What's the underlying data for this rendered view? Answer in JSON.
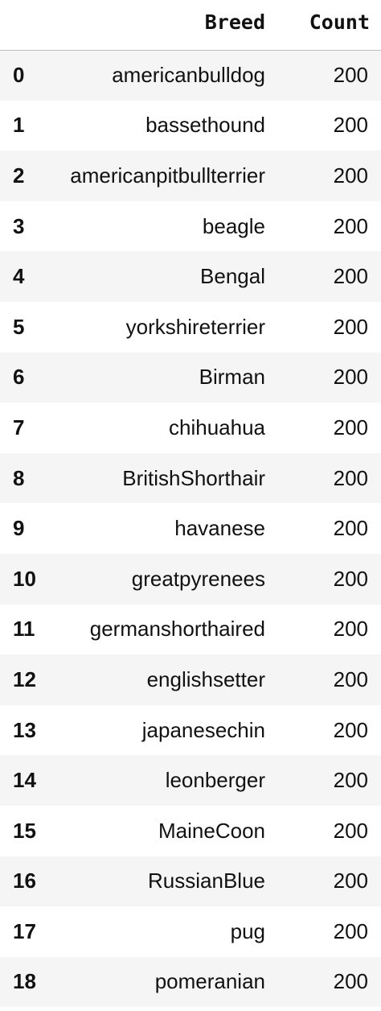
{
  "table": {
    "columns": {
      "index": "",
      "breed": "Breed",
      "count": "Count"
    },
    "rows": [
      {
        "index": "0",
        "breed": "americanbulldog",
        "count": "200"
      },
      {
        "index": "1",
        "breed": "bassethound",
        "count": "200"
      },
      {
        "index": "2",
        "breed": "americanpitbullterrier",
        "count": "200"
      },
      {
        "index": "3",
        "breed": "beagle",
        "count": "200"
      },
      {
        "index": "4",
        "breed": "Bengal",
        "count": "200"
      },
      {
        "index": "5",
        "breed": "yorkshireterrier",
        "count": "200"
      },
      {
        "index": "6",
        "breed": "Birman",
        "count": "200"
      },
      {
        "index": "7",
        "breed": "chihuahua",
        "count": "200"
      },
      {
        "index": "8",
        "breed": "BritishShorthair",
        "count": "200"
      },
      {
        "index": "9",
        "breed": "havanese",
        "count": "200"
      },
      {
        "index": "10",
        "breed": "greatpyrenees",
        "count": "200"
      },
      {
        "index": "11",
        "breed": "germanshorthaired",
        "count": "200"
      },
      {
        "index": "12",
        "breed": "englishsetter",
        "count": "200"
      },
      {
        "index": "13",
        "breed": "japanesechin",
        "count": "200"
      },
      {
        "index": "14",
        "breed": "leonberger",
        "count": "200"
      },
      {
        "index": "15",
        "breed": "MaineCoon",
        "count": "200"
      },
      {
        "index": "16",
        "breed": "RussianBlue",
        "count": "200"
      },
      {
        "index": "17",
        "breed": "pug",
        "count": "200"
      },
      {
        "index": "18",
        "breed": "pomeranian",
        "count": "200"
      }
    ]
  },
  "colors": {
    "stripe": "#f5f5f5",
    "background": "#ffffff",
    "text": "#111111",
    "header_rule": "#bdbdbd"
  }
}
